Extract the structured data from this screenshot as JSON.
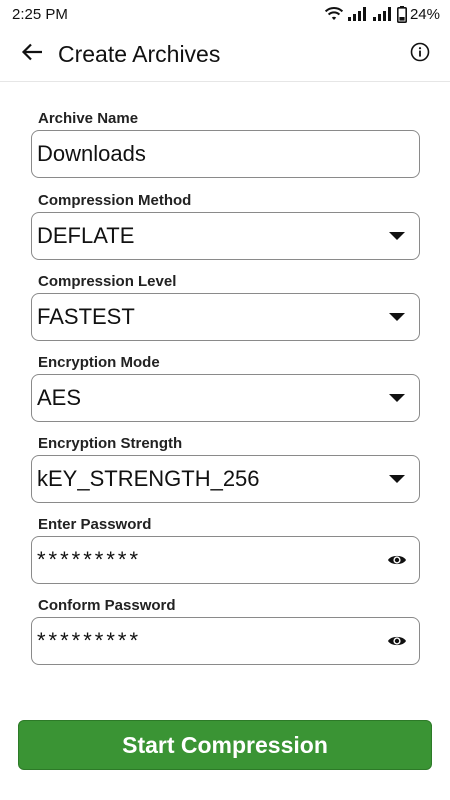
{
  "status": {
    "time": "2:25 PM",
    "battery": "24%"
  },
  "header": {
    "title": "Create Archives"
  },
  "fields": {
    "archive_name": {
      "label": "Archive Name",
      "value": "Downloads"
    },
    "compression_method": {
      "label": "Compression Method",
      "value": "DEFLATE"
    },
    "compression_level": {
      "label": "Compression Level",
      "value": "FASTEST"
    },
    "encryption_mode": {
      "label": "Encryption Mode",
      "value": "AES"
    },
    "encryption_strength": {
      "label": "Encryption Strength",
      "value": "kEY_STRENGTH_256"
    },
    "password": {
      "label": "Enter Password",
      "value": "*********"
    },
    "confirm_password": {
      "label": "Conform Password",
      "value": "*********"
    }
  },
  "actions": {
    "start_label": "Start Compression"
  },
  "colors": {
    "accent": "#3a9434"
  },
  "icons": {
    "back": "arrow-left-icon",
    "info": "info-icon",
    "dropdown": "caret-down-icon",
    "visibility": "eye-icon"
  }
}
